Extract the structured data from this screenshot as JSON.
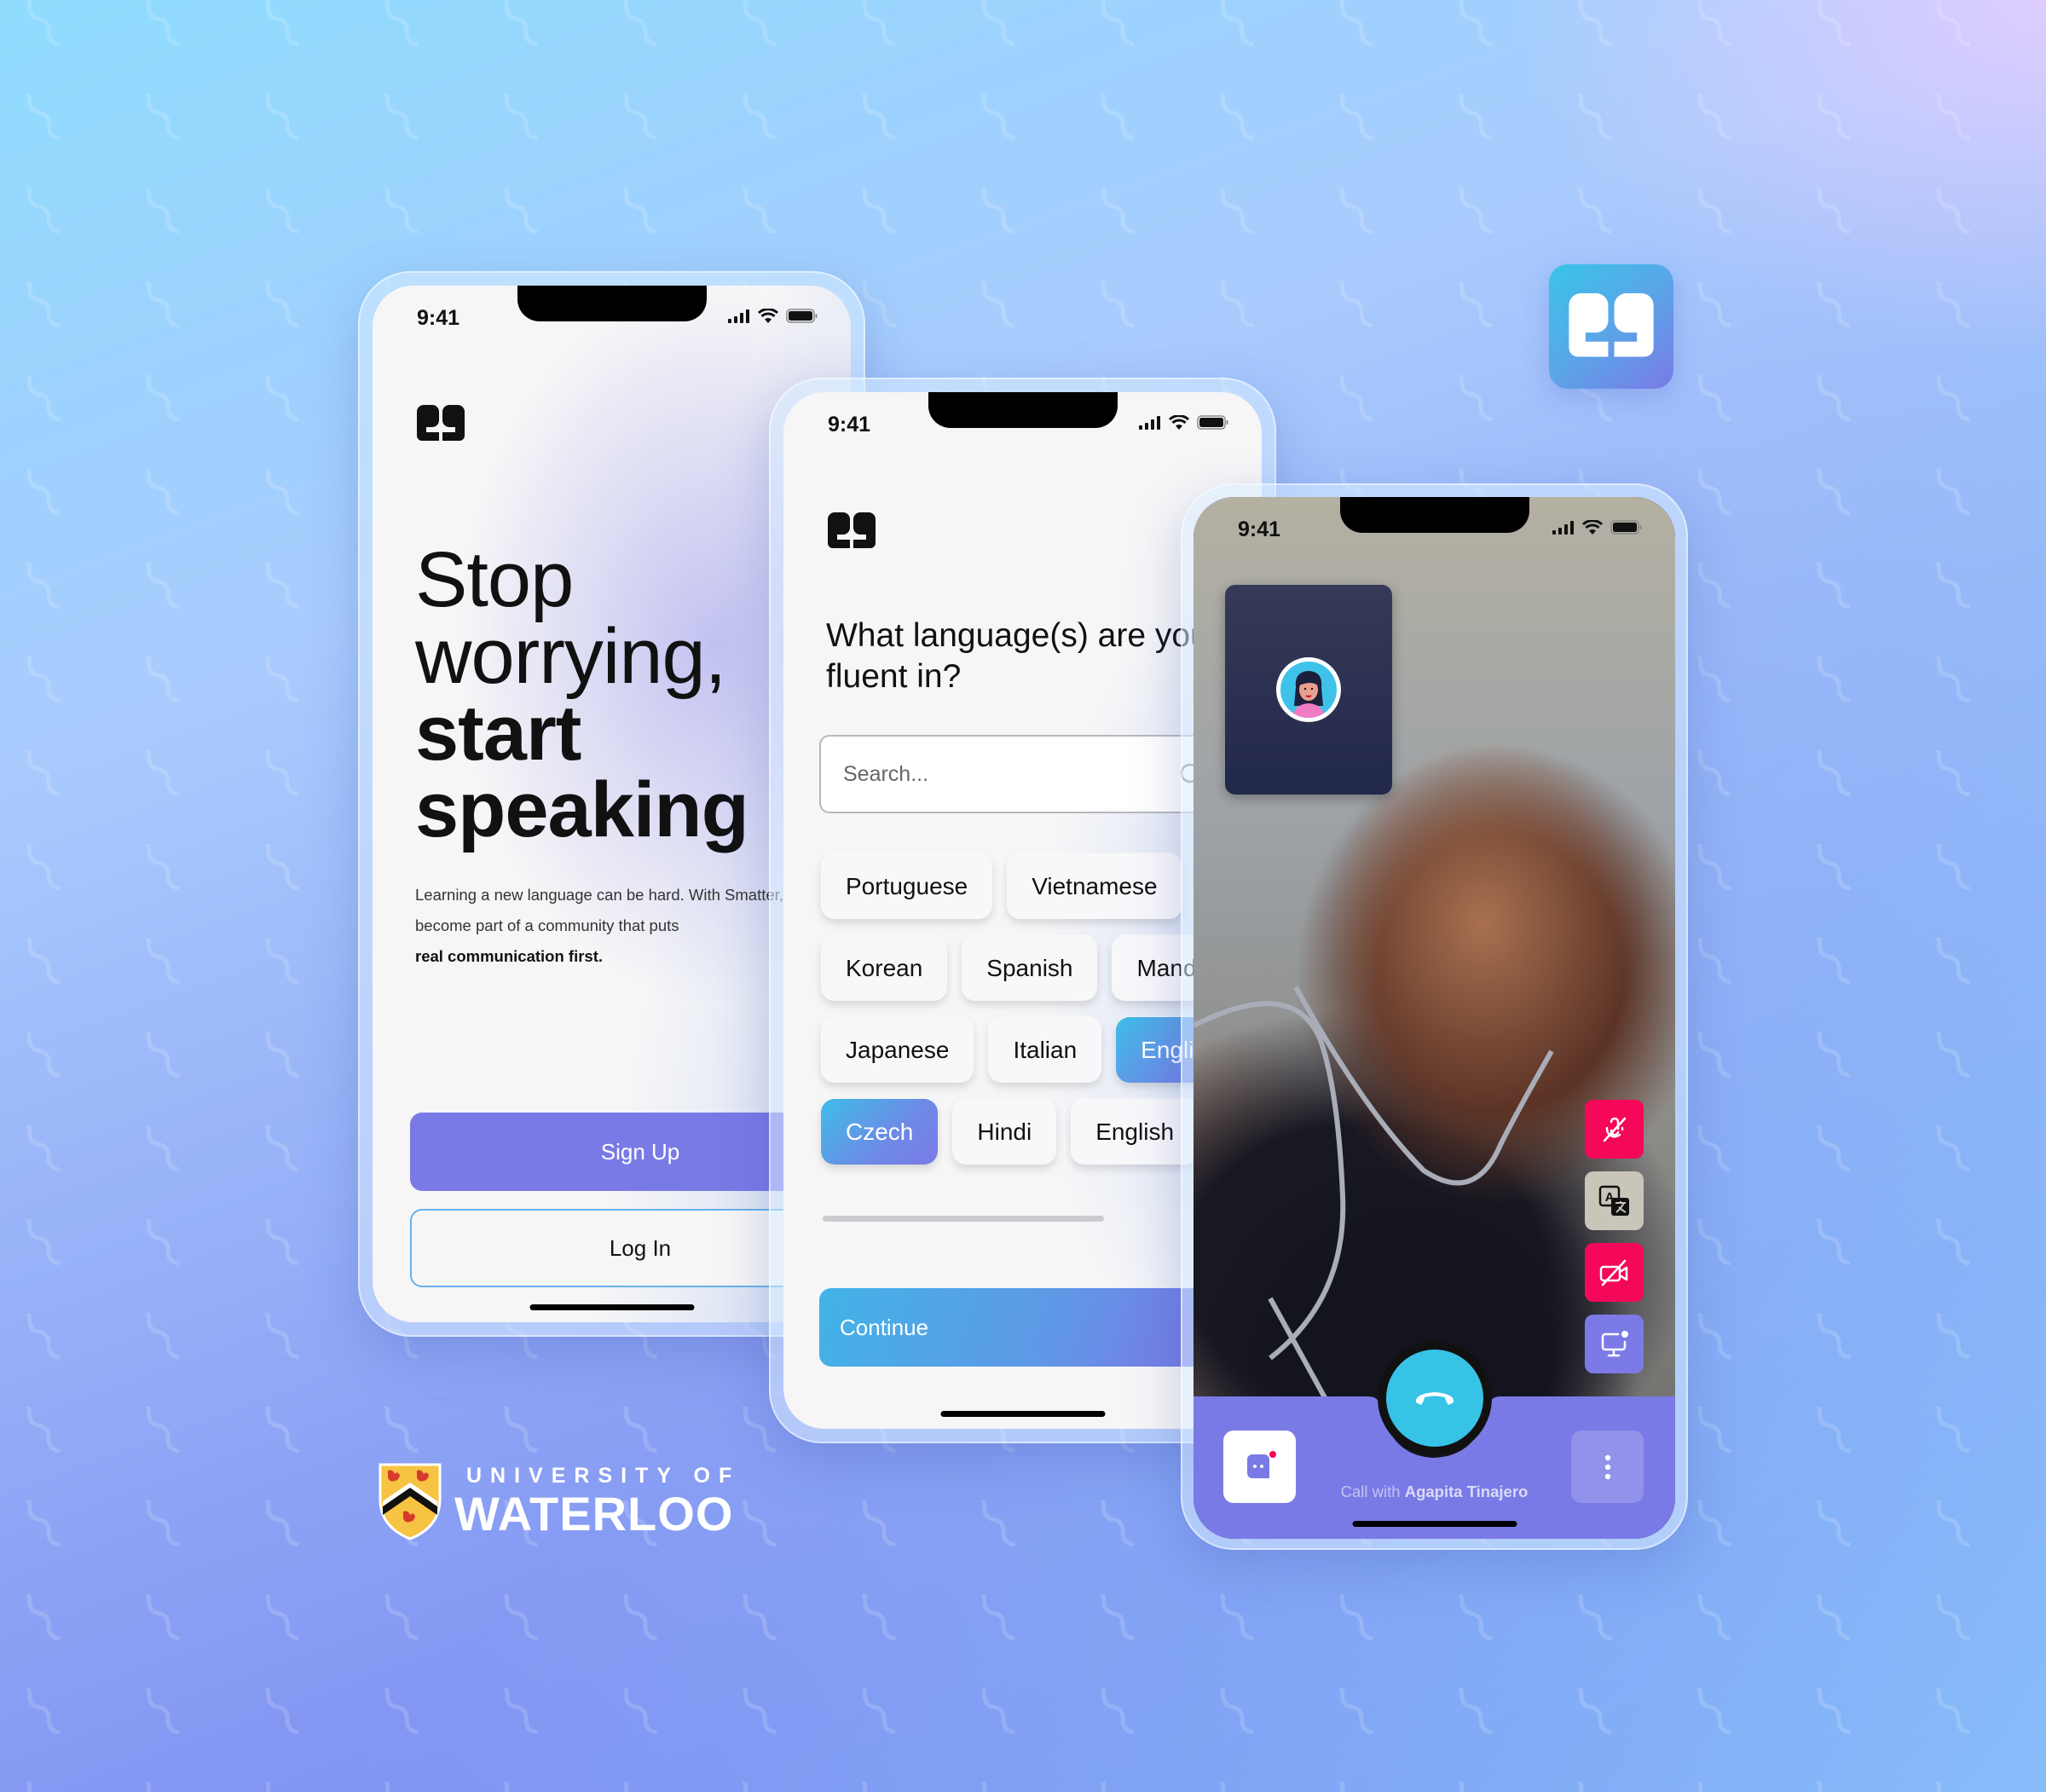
{
  "status_bar": {
    "time": "9:41"
  },
  "phone_welcome": {
    "heading_light": [
      "Stop",
      "worrying,"
    ],
    "heading_bold": [
      "start",
      "speaking"
    ],
    "body_lines": [
      "Learning a new language can be hard. With Smatter,",
      "become part of a community that puts"
    ],
    "body_strong": "real communication first.",
    "signup_label": "Sign Up",
    "login_label": "Log In"
  },
  "phone_languages": {
    "question": "What language(s) are you fluent in?",
    "question_lines": [
      "What language(s) are you",
      "fluent in?"
    ],
    "search_placeholder": "Search...",
    "language_rows": [
      [
        {
          "label": "Portuguese",
          "selected": false
        },
        {
          "label": "Vietnamese",
          "selected": false
        }
      ],
      [
        {
          "label": "Korean",
          "selected": false
        },
        {
          "label": "Spanish",
          "selected": false
        },
        {
          "label": "Mandarin",
          "selected": false
        }
      ],
      [
        {
          "label": "Japanese",
          "selected": false
        },
        {
          "label": "Italian",
          "selected": false
        },
        {
          "label": "English",
          "selected": true
        }
      ],
      [
        {
          "label": "Czech",
          "selected": true
        },
        {
          "label": "Hindi",
          "selected": false
        },
        {
          "label": "English",
          "selected": false
        }
      ]
    ],
    "continue_label": "Continue"
  },
  "phone_call": {
    "controls": [
      {
        "name": "mute-microphone",
        "icon": "mic-off-icon",
        "state": "off"
      },
      {
        "name": "translate",
        "icon": "translate-icon",
        "state": "neutral"
      },
      {
        "name": "camera",
        "icon": "video-off-icon",
        "state": "off"
      },
      {
        "name": "screen-share",
        "icon": "screen-share-icon",
        "state": "accent"
      }
    ],
    "caller_prefix": "Call with",
    "caller_name": "Agapita Tinajero"
  },
  "branding": {
    "university_top": "UNIVERSITY OF",
    "university_bottom": "WATERLOO"
  },
  "colors": {
    "accent_purple": "#7a7ae6",
    "accent_cyan": "#36c3e6",
    "danger_pink": "#f5085a",
    "chip_bg": "#f8f8fa"
  }
}
